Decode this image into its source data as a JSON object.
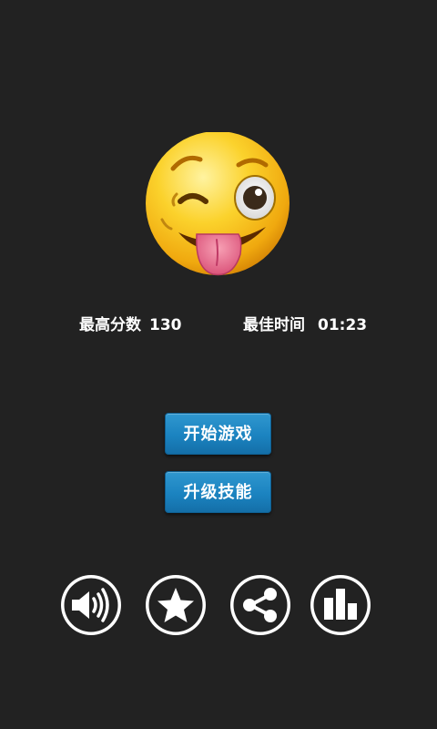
{
  "stats": {
    "best_score_label": "最高分数",
    "best_score_value": "130",
    "best_time_label": "最佳时间",
    "best_time_value": "01:23"
  },
  "buttons": {
    "start_label": "开始游戏",
    "upgrade_label": "升级技能"
  },
  "icons": [
    "sound-icon",
    "star-icon",
    "share-icon",
    "leaderboard-icon",
    "winking-tongue-emoji-icon"
  ],
  "colors": {
    "background": "#222222",
    "button_blue": "#1b83c0",
    "emoji_yellow": "#f7c61a"
  }
}
